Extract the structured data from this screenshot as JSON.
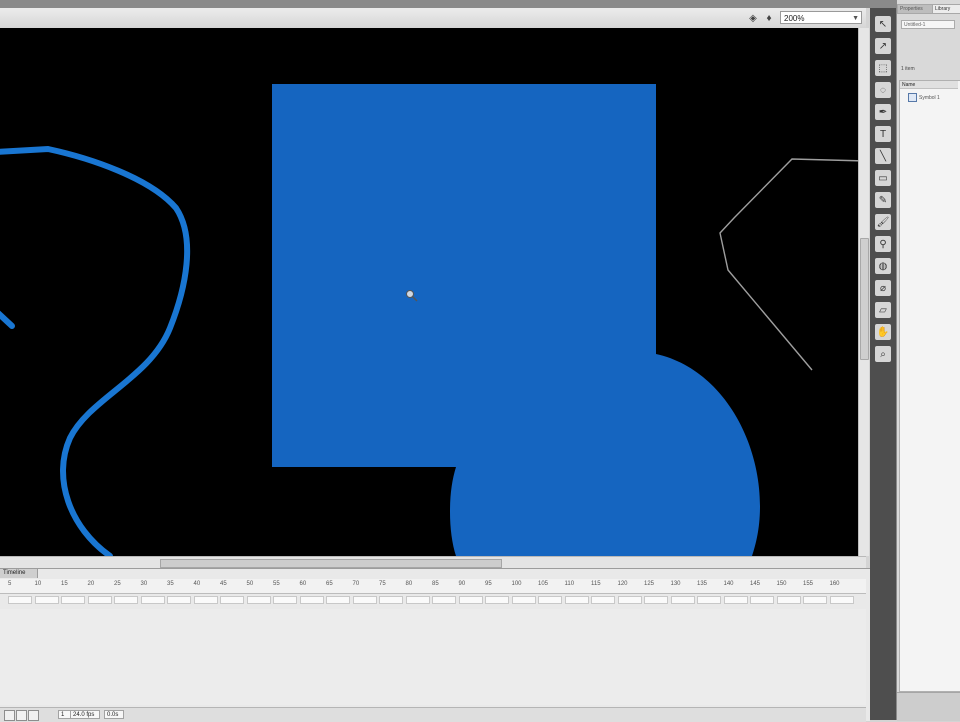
{
  "editbar": {
    "zoom_value": "200%",
    "edit_symbols_icon": "edit-symbols-icon",
    "edit_scene_icon": "edit-scene-icon"
  },
  "stage": {
    "background": "#000000",
    "shape_fill": "#1565c0",
    "stroke_blue": "#1976d2",
    "stroke_grey": "#9e9e9e"
  },
  "timeline": {
    "tab_label": "Timeline",
    "ruler_labels": [
      "5",
      "10",
      "15",
      "20",
      "25",
      "30",
      "35",
      "40",
      "45",
      "50",
      "55",
      "60",
      "65",
      "70",
      "75",
      "80",
      "85",
      "90",
      "95",
      "100",
      "105",
      "110",
      "115",
      "120",
      "125",
      "130",
      "135",
      "140",
      "145",
      "150",
      "155",
      "160"
    ],
    "status": {
      "frame": "1",
      "fps": "24.0 fps",
      "time": "0.0s"
    }
  },
  "tools": [
    "selection-tool-icon",
    "subselection-tool-icon",
    "free-transform-icon",
    "lasso-icon",
    "pen-icon",
    "text-icon",
    "line-icon",
    "rectangle-icon",
    "pencil-icon",
    "brush-icon",
    "bone-icon",
    "paint-bucket-icon",
    "eyedropper-icon",
    "eraser-icon",
    "hand-icon",
    "zoom-icon"
  ],
  "panel": {
    "tabs": [
      "Properties",
      "Library"
    ],
    "doc_field": "Untitled-1",
    "items_count": "1 item",
    "list_header": "Name",
    "library_item": "Symbol 1"
  }
}
